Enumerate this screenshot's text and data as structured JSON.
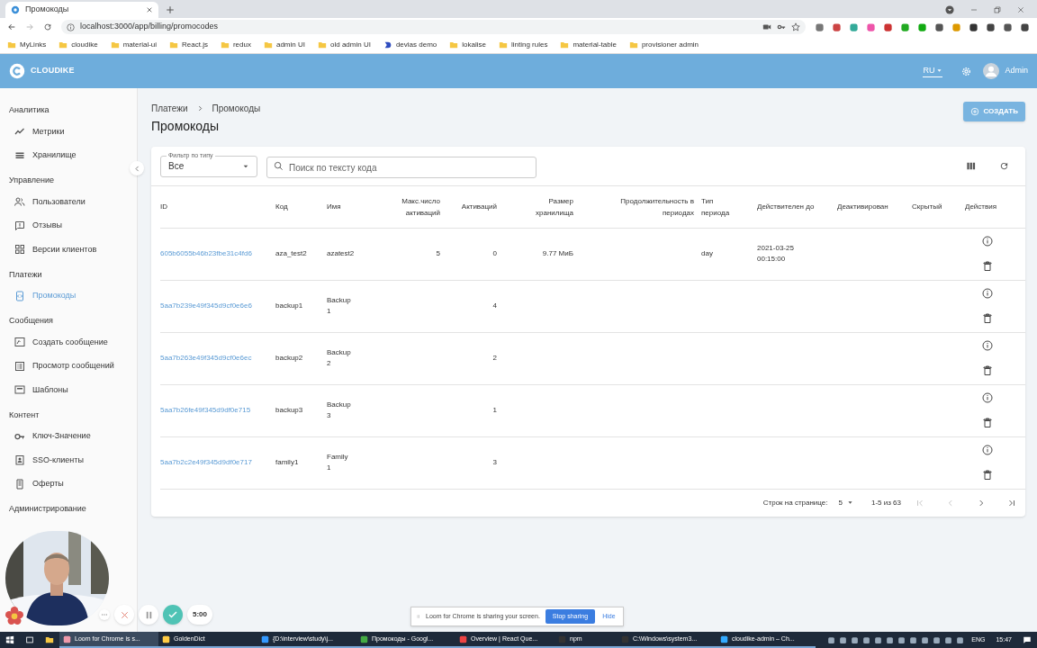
{
  "browser": {
    "tab_title": "Промокоды",
    "url": "localhost:3000/app/billing/promocodes",
    "bookmarks": [
      {
        "label": "MyLinks",
        "kind": "folder"
      },
      {
        "label": "cloudike",
        "kind": "folder"
      },
      {
        "label": "material-ui",
        "kind": "folder"
      },
      {
        "label": "React.js",
        "kind": "folder"
      },
      {
        "label": "redux",
        "kind": "folder"
      },
      {
        "label": "admin UI",
        "kind": "folder"
      },
      {
        "label": "old admin UI",
        "kind": "folder"
      },
      {
        "label": "devias demo",
        "kind": "link"
      },
      {
        "label": "lokalise",
        "kind": "folder"
      },
      {
        "label": "linting rules",
        "kind": "folder"
      },
      {
        "label": "material-table",
        "kind": "folder"
      },
      {
        "label": "provisioner admin",
        "kind": "folder"
      }
    ]
  },
  "header": {
    "logo": "CLOUDIKE",
    "language": "RU",
    "user": "Admin"
  },
  "sidebar": {
    "sections": [
      {
        "title": "Аналитика",
        "items": [
          {
            "label": "Метрики",
            "selected": false
          },
          {
            "label": "Хранилище",
            "selected": false
          }
        ]
      },
      {
        "title": "Управление",
        "items": [
          {
            "label": "Пользователи",
            "selected": false
          },
          {
            "label": "Отзывы",
            "selected": false
          },
          {
            "label": "Версии клиентов",
            "selected": false
          }
        ]
      },
      {
        "title": "Платежи",
        "items": [
          {
            "label": "Промокоды",
            "selected": true
          }
        ]
      },
      {
        "title": "Сообщения",
        "items": [
          {
            "label": "Создать сообщение",
            "selected": false
          },
          {
            "label": "Просмотр сообщений",
            "selected": false
          },
          {
            "label": "Шаблоны",
            "selected": false
          }
        ]
      },
      {
        "title": "Контент",
        "items": [
          {
            "label": "Ключ-Значение",
            "selected": false
          },
          {
            "label": "SSO-клиенты",
            "selected": false
          },
          {
            "label": "Оферты",
            "selected": false
          }
        ]
      },
      {
        "title": "Администрирование"
      }
    ]
  },
  "breadcrumbs": [
    "Платежи",
    "Промокоды"
  ],
  "page_title": "Промокоды",
  "create_button": "СОЗДАТЬ",
  "filter": {
    "label": "Фильтр по типу",
    "value": "Все"
  },
  "search": {
    "placeholder": "Поиск по тексту кода"
  },
  "table": {
    "columns": [
      "ID",
      "Код",
      "Имя",
      "Макс.число активаций",
      "Активаций",
      "Размер хранилища",
      "Продолжительность в периодах",
      "Тип периода",
      "Действителен до",
      "Деактивирован",
      "Скрытый",
      "Действия"
    ],
    "rows": [
      {
        "id": "605b6055b46b23fbe31c4fd6",
        "code": "aza_test2",
        "name": "azatest2",
        "max_activations": "5",
        "activations": "0",
        "storage": "9.77 МиБ",
        "period_type": "day",
        "valid_until": "2021-03-25 00:15:00"
      },
      {
        "id": "5aa7b239e49f345d9cf0e6e6",
        "code": "backup1",
        "name": "Backup 1",
        "activations": "4"
      },
      {
        "id": "5aa7b263e49f345d9cf0e6ec",
        "code": "backup2",
        "name": "Backup 2",
        "activations": "2"
      },
      {
        "id": "5aa7b26fe49f345d9df0e715",
        "code": "backup3",
        "name": "Backup 3",
        "activations": "1"
      },
      {
        "id": "5aa7b2c2e49f345d9df0e717",
        "code": "family1",
        "name": "Family 1",
        "activations": "3"
      }
    ]
  },
  "pagination": {
    "rows_per_page_label": "Строк на странице:",
    "rows_per_page": "5",
    "range": "1-5 из 63"
  },
  "recorder": {
    "timer": "5:00",
    "message": "Loom for Chrome is sharing your screen.",
    "stop_button": "Stop sharing",
    "hide_button": "Hide"
  },
  "taskbar": {
    "items": [
      "Loom for Chrome is s...",
      "GoldenDict",
      "{D:\\interview\\study\\j...",
      "Промокоды - Googl...",
      "Overview | React Que...",
      "npm",
      "C:\\Windows\\system3...",
      "cloudike-admin – Ch..."
    ],
    "language": "ENG",
    "time": "15:47"
  }
}
